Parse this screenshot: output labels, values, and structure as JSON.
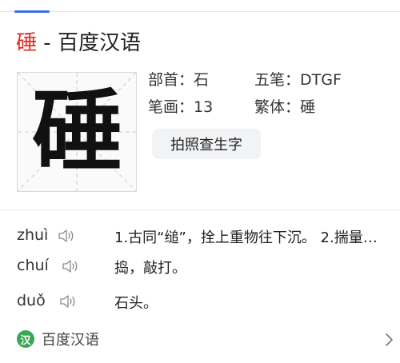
{
  "title": {
    "character": "硾",
    "separator": " - ",
    "site": "百度汉语"
  },
  "glyph": "硾",
  "info": {
    "radical": "部首：石",
    "wubi": "五笔：DTGF",
    "strokes": "笔画：13",
    "traditional": "繁体：硾"
  },
  "lookup_button": "拍照查生字",
  "pronunciations": [
    {
      "pinyin": "zhuì",
      "definition": "1.古同“缒”，拴上重物往下沉。 2.揣量…"
    },
    {
      "pinyin": "chuí",
      "definition": "捣，敲打。"
    },
    {
      "pinyin": "duǒ",
      "definition": "石头。"
    }
  ],
  "footer": {
    "logo_text": "汉",
    "name": "百度汉语"
  },
  "colors": {
    "accent_blue": "#3b6ef5",
    "title_red": "#e0291e",
    "logo_green": "#3aa757"
  },
  "icons": {
    "speaker": "speaker-icon",
    "chevron": "chevron-right-icon"
  }
}
